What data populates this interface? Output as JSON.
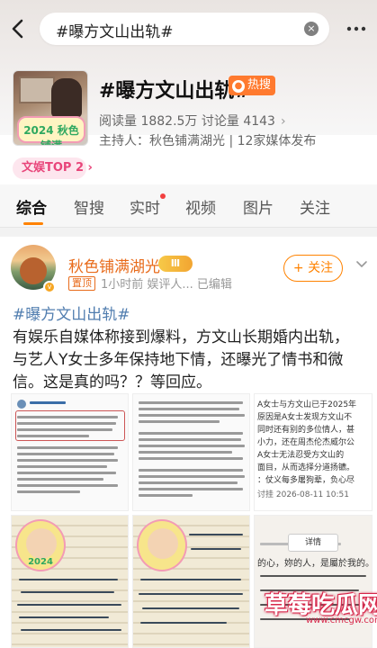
{
  "search": {
    "query": "#曝方文山出轨#",
    "clear_symbol": "×"
  },
  "topic": {
    "title": "#曝方文山出轨#",
    "hot_label": "热搜",
    "stats": "阅读量 1882.5万  讨论量 4143",
    "chevron": "›",
    "host": "主持人：秋色铺满湖光 | 12家媒体发布",
    "rank_label": "文娱TOP 2 ›",
    "thumb_badge": "2024 秋色铺满"
  },
  "tabs": [
    {
      "label": "综合",
      "active": true
    },
    {
      "label": "智搜",
      "active": false
    },
    {
      "label": "实时",
      "active": false
    },
    {
      "label": "视频",
      "active": false
    },
    {
      "label": "图片",
      "active": false
    },
    {
      "label": "关注",
      "active": false
    }
  ],
  "post": {
    "author": "秋色铺满湖光",
    "level_badge": "Ⅲ",
    "pin_label": "置顶",
    "meta": "1小时前  娱评人...  已编辑",
    "follow_label": "+ 关注",
    "hashtag": "#曝方文山出轨#",
    "lines": [
      "有娱乐自媒体称接到爆料，方文山长期婚内出轨，",
      "与艺人Y女士多年保持地下情，还曝光了情书和微",
      "信。这是真的吗？？等回应。"
    ],
    "image_captions": {
      "right_top_1": "A女士与方文山已于2025年",
      "right_top_2": "原因是A女士发现方文山不",
      "right_top_3": "同时还有别的多位情人，甚",
      "right_top_4": "小力，还在周杰伦杰威尔公",
      "right_top_5": "A女士无法忍受方文山的",
      "right_top_6": "面目，从而选择分道扬镳。",
      "right_top_7": "：仗义每多屠狗辈，负心尽",
      "right_top_8": "讨挂 2026-08-11 10:51",
      "detail_button": "详情",
      "note_bottom": "的心，妳的人，是屬於我的。妳的",
      "sticker_text": "2024"
    }
  },
  "watermark": {
    "title": "草莓吃瓜网",
    "url": "www.cmcgw.com"
  }
}
